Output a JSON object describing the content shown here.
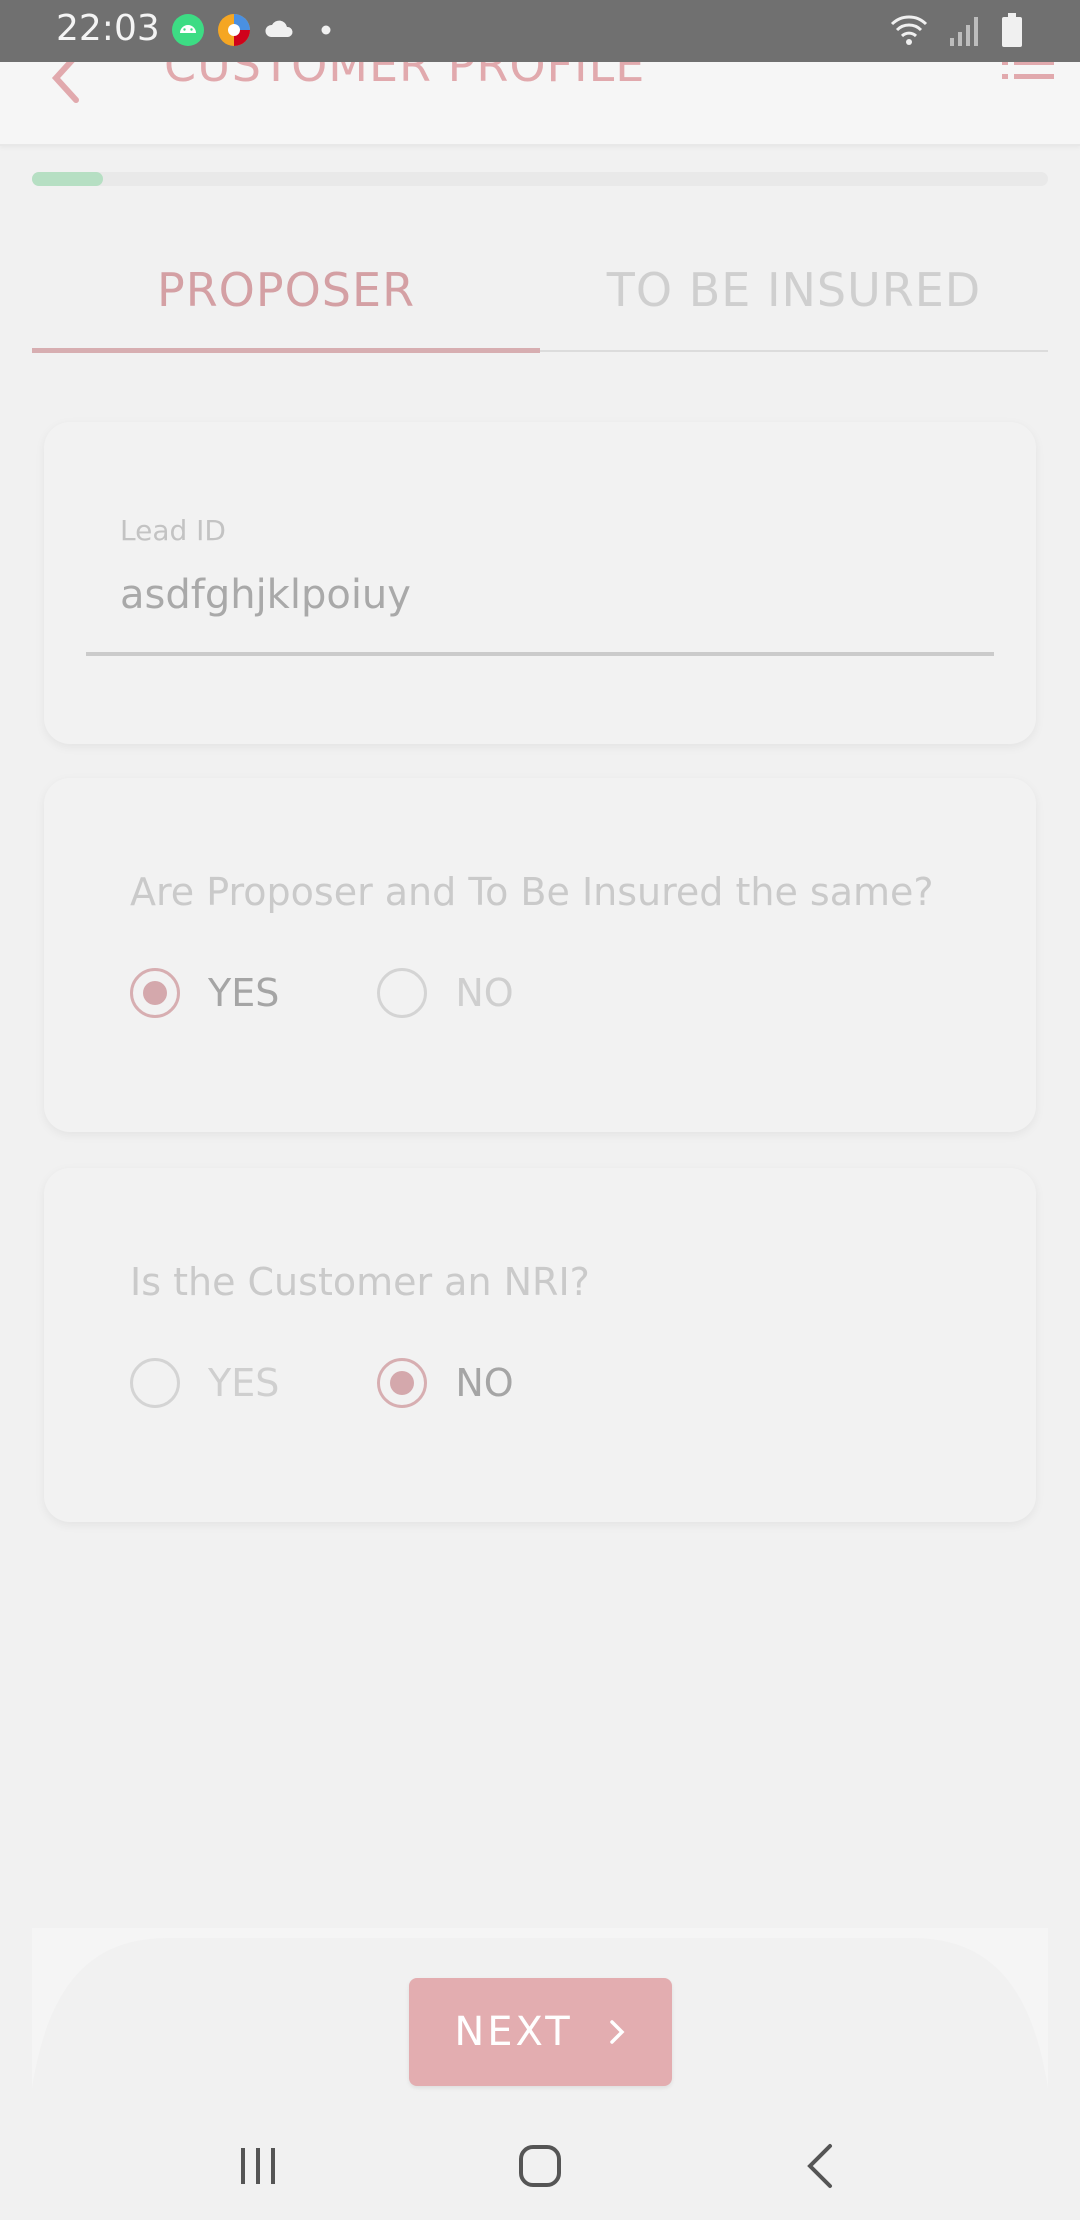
{
  "status_bar": {
    "time": "22:03"
  },
  "header": {
    "title": "CUSTOMER PROFILE",
    "back_icon": "back-arrow-icon",
    "menu_icon": "list-menu-icon"
  },
  "progress": {
    "fraction": 0.07
  },
  "tabs": [
    {
      "label": "PROPOSER",
      "active": true
    },
    {
      "label": "TO BE INSURED",
      "active": false
    }
  ],
  "lead": {
    "label": "Lead ID",
    "value": "asdfghjklpoiuy"
  },
  "same_question": {
    "text": "Are Proposer and To Be Insured the same?",
    "options": [
      "YES",
      "NO"
    ],
    "selected": "YES"
  },
  "nri_question": {
    "text": "Is the Customer an NRI?",
    "options": [
      "YES",
      "NO"
    ],
    "selected": "NO"
  },
  "footer": {
    "next_label": "NEXT"
  },
  "colors": {
    "accent": "#e3adb0",
    "progress": "#b6dfc3",
    "tab_active": "#d4a0a4"
  }
}
